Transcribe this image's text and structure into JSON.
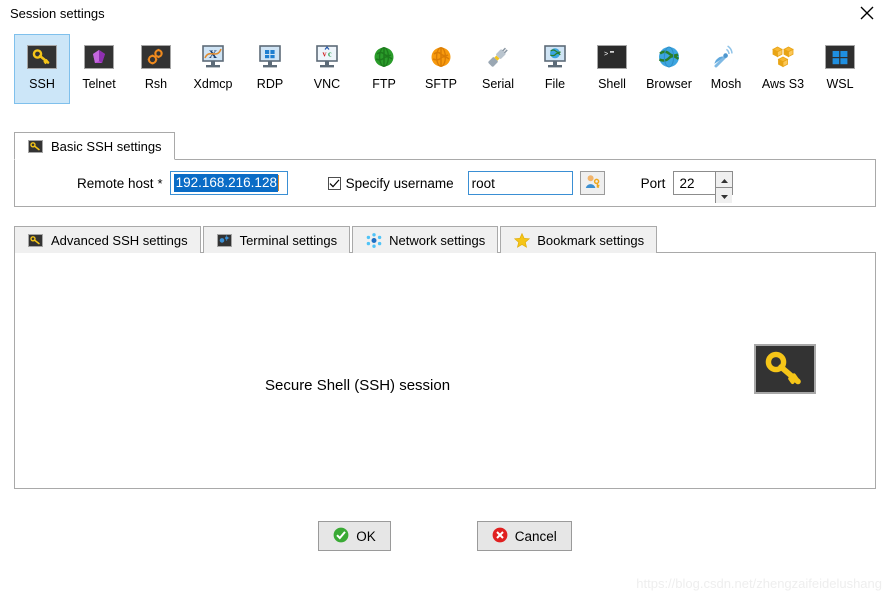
{
  "window": {
    "title": "Session settings",
    "close_label": "×",
    "close_icon": "close-icon"
  },
  "session_types": [
    {
      "label": "SSH",
      "icon": "ssh-key-icon",
      "selected": true
    },
    {
      "label": "Telnet",
      "icon": "telnet-gem-icon",
      "selected": false
    },
    {
      "label": "Rsh",
      "icon": "rsh-gears-icon",
      "selected": false
    },
    {
      "label": "Xdmcp",
      "icon": "xdmcp-monitor-icon",
      "selected": false
    },
    {
      "label": "RDP",
      "icon": "rdp-monitor-icon",
      "selected": false
    },
    {
      "label": "VNC",
      "icon": "vnc-monitor-icon",
      "selected": false
    },
    {
      "label": "FTP",
      "icon": "ftp-globe-icon",
      "selected": false
    },
    {
      "label": "SFTP",
      "icon": "sftp-globe-icon",
      "selected": false
    },
    {
      "label": "Serial",
      "icon": "serial-plug-icon",
      "selected": false
    },
    {
      "label": "File",
      "icon": "file-monitor-icon",
      "selected": false
    },
    {
      "label": "Shell",
      "icon": "shell-prompt-icon",
      "selected": false
    },
    {
      "label": "Browser",
      "icon": "browser-globe-icon",
      "selected": false
    },
    {
      "label": "Mosh",
      "icon": "mosh-dish-icon",
      "selected": false
    },
    {
      "label": "Aws S3",
      "icon": "aws-s3-cubes-icon",
      "selected": false
    },
    {
      "label": "WSL",
      "icon": "wsl-windows-icon",
      "selected": false
    }
  ],
  "basic_tab": {
    "label": "Basic SSH settings",
    "icon": "key-icon"
  },
  "basic_form": {
    "remote_host_label": "Remote host",
    "remote_host_required": "*",
    "remote_host_value": "192.168.216.128",
    "specify_username_label": "Specify username",
    "specify_username_checked": true,
    "username_value": "root",
    "username_placeholder": "",
    "user_button_icon": "user-key-icon",
    "port_label": "Port",
    "port_value": "22",
    "spin_up_icon": "caret-up-icon",
    "spin_down_icon": "caret-down-icon"
  },
  "settings_tabs": [
    {
      "label": "Advanced SSH settings",
      "icon": "key-icon",
      "active": false
    },
    {
      "label": "Terminal settings",
      "icon": "terminal-icon",
      "active": false
    },
    {
      "label": "Network settings",
      "icon": "network-icon",
      "active": false
    },
    {
      "label": "Bookmark settings",
      "icon": "star-icon",
      "active": false
    }
  ],
  "content_pane": {
    "caption": "Secure Shell (SSH) session",
    "illustration_icon": "ssh-key-large-icon"
  },
  "footer": {
    "ok_label": "OK",
    "ok_icon": "check-circle-icon",
    "cancel_label": "Cancel",
    "cancel_icon": "x-circle-icon"
  },
  "watermark": {
    "text": "https://blog.csdn.net/zhengzaifeidelushang"
  },
  "colors": {
    "selected_tab_bg": "#cce6f8",
    "selected_tab_border": "#7fc0ec",
    "input_border": "#3a8fd4",
    "selection_bg": "#0a6cc6",
    "ok_green": "#3aaa35",
    "cancel_red": "#e02020",
    "key_gold": "#f5c518",
    "tile_dark": "#333333"
  }
}
